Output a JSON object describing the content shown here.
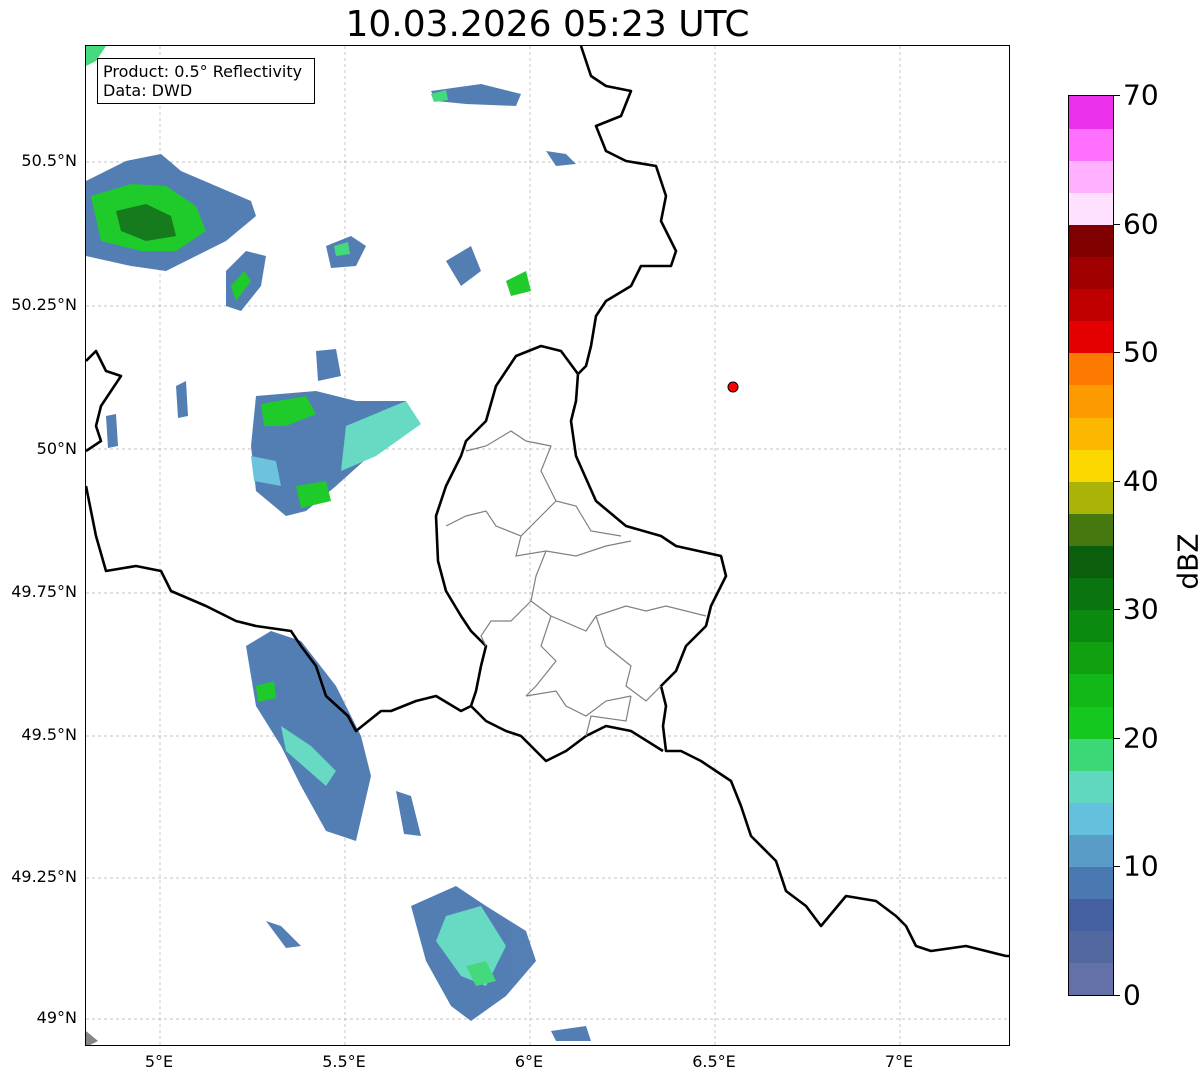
{
  "title": "10.03.2026 05:23 UTC",
  "info": {
    "product": "Product: 0.5° Reflectivity",
    "data": "Data: DWD"
  },
  "lat_labels": [
    "50.5°N",
    "50.25°N",
    "50°N",
    "49.75°N",
    "49.5°N",
    "49.25°N",
    "49°N"
  ],
  "lon_labels": [
    "5°E",
    "5.5°E",
    "6°E",
    "6.5°E",
    "7°E"
  ],
  "colorbar": {
    "unit": "dBZ",
    "ticks": [
      "0",
      "10",
      "20",
      "30",
      "40",
      "50",
      "60",
      "70"
    ],
    "colors": [
      "#6470a8",
      "#5468a0",
      "#4460a0",
      "#4a78b0",
      "#5a9cc8",
      "#64c0dc",
      "#60d8c0",
      "#3cd878",
      "#14c820",
      "#12b818",
      "#10a010",
      "#0c8a10",
      "#0a7410",
      "#0a5e0c",
      "#467810",
      "#aab408",
      "#fcd800",
      "#fcb800",
      "#fc9a00",
      "#fc7a00",
      "#e40000",
      "#c00000",
      "#a00000",
      "#800000",
      "#ffe0ff",
      "#ffb0ff",
      "#ff70ff",
      "#ec30ec"
    ],
    "range": [
      0,
      70
    ]
  },
  "marker": {
    "label": "",
    "color": "#ff0000"
  },
  "colors": {
    "border": "#000000",
    "district": "#808080",
    "grid": "#b0b0b0"
  }
}
